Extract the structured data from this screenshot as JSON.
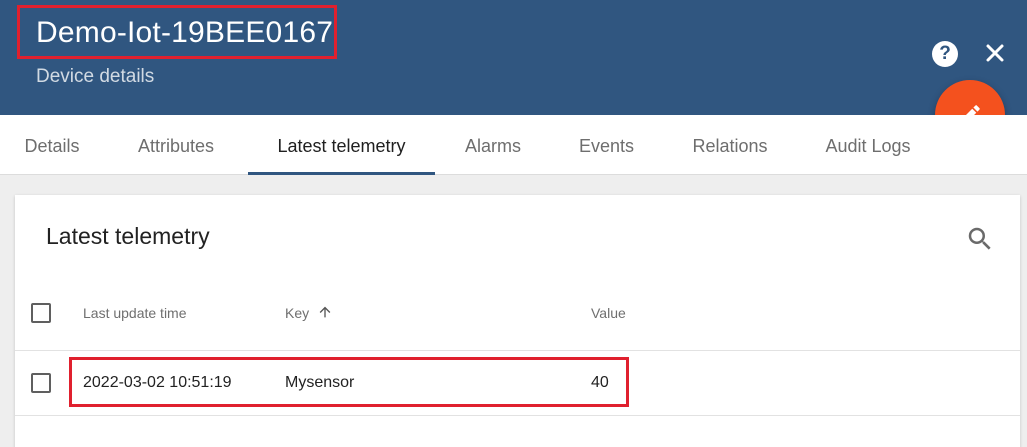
{
  "header": {
    "device_title": "Demo-Iot-19BEE0167",
    "device_subtitle": "Device details",
    "help_icon": "help-circle-icon",
    "close_icon": "close-icon",
    "edit_icon": "pencil-icon"
  },
  "tabs": [
    {
      "label": "Details",
      "active": false
    },
    {
      "label": "Attributes",
      "active": false
    },
    {
      "label": "Latest telemetry",
      "active": true
    },
    {
      "label": "Alarms",
      "active": false
    },
    {
      "label": "Events",
      "active": false
    },
    {
      "label": "Relations",
      "active": false
    },
    {
      "label": "Audit Logs",
      "active": false
    }
  ],
  "telemetry": {
    "title": "Latest telemetry",
    "search_icon": "search-icon",
    "columns": {
      "last_update_time": "Last update time",
      "key": "Key",
      "value": "Value"
    },
    "sort_icon": "arrow-up-icon",
    "rows": [
      {
        "last_update_time": "2022-03-02 10:51:19",
        "key": "Mysensor",
        "value": "40"
      }
    ]
  },
  "colors": {
    "header_bg": "#305680",
    "fab": "#f4511e",
    "highlight_box": "#e0202e"
  }
}
